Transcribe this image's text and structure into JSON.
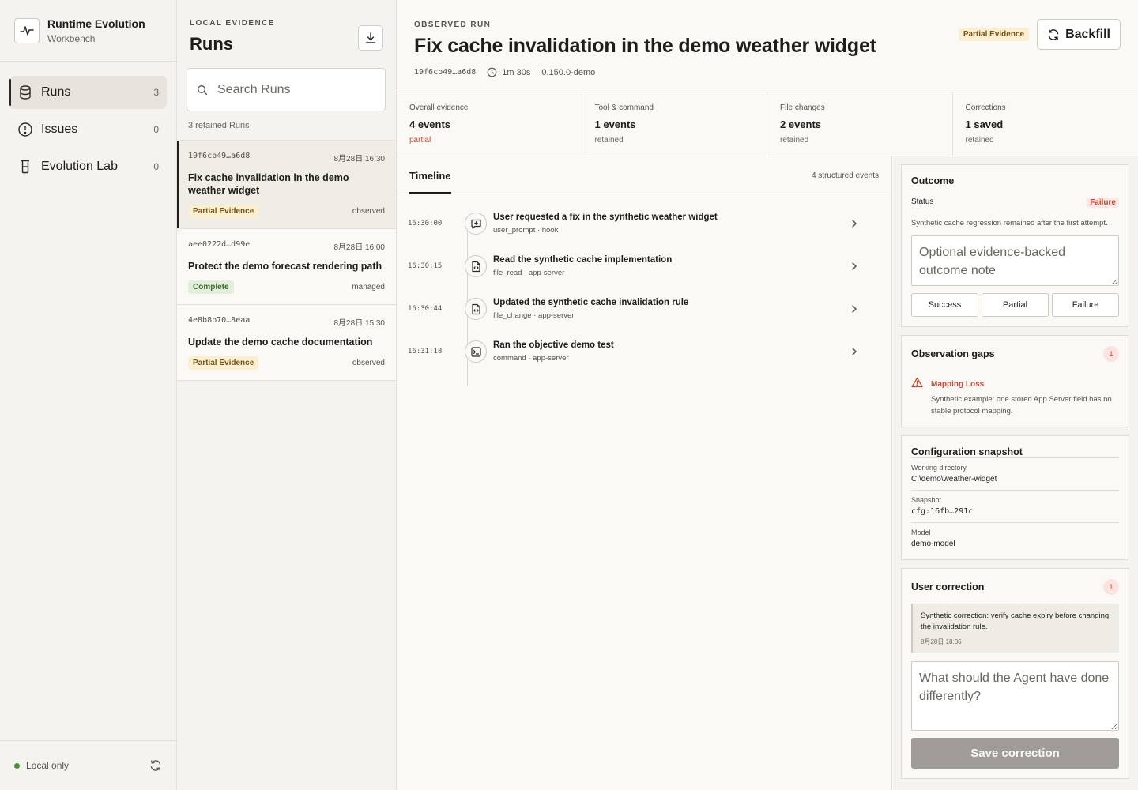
{
  "app": {
    "title": "Runtime Evolution",
    "subtitle": "Workbench"
  },
  "nav": [
    {
      "label": "Runs",
      "count": "3"
    },
    {
      "label": "Issues",
      "count": "0"
    },
    {
      "label": "Evolution Lab",
      "count": "0"
    }
  ],
  "footer": {
    "status": "Local only"
  },
  "runs_panel": {
    "eyebrow": "LOCAL EVIDENCE",
    "title": "Runs",
    "search_placeholder": "Search Runs",
    "count_text": "3 retained Runs",
    "runs": [
      {
        "id": "19f6cb49…a6d8",
        "date": "8月28日 16:30",
        "title": "Fix cache invalidation in the demo weather widget",
        "badge": "Partial Evidence",
        "state": "observed"
      },
      {
        "id": "aee0222d…d99e",
        "date": "8月28日 16:00",
        "title": "Protect the demo forecast rendering path",
        "badge": "Complete",
        "state": "managed"
      },
      {
        "id": "4e8b8b70…8eaa",
        "date": "8月28日 15:30",
        "title": "Update the demo cache documentation",
        "badge": "Partial Evidence",
        "state": "observed"
      }
    ]
  },
  "run": {
    "eyebrow": "OBSERVED RUN",
    "title": "Fix cache invalidation in the demo weather widget",
    "id": "19f6cb49…a6d8",
    "duration": "1m 30s",
    "version": "0.150.0-demo",
    "badge": "Partial Evidence",
    "backfill_label": "Backfill"
  },
  "stats": [
    {
      "label": "Overall evidence",
      "value": "4 events",
      "sub": "partial"
    },
    {
      "label": "Tool & command",
      "value": "1 events",
      "sub": "retained"
    },
    {
      "label": "File changes",
      "value": "2 events",
      "sub": "retained"
    },
    {
      "label": "Corrections",
      "value": "1 saved",
      "sub": "retained"
    }
  ],
  "timeline": {
    "tab": "Timeline",
    "count_text": "4 structured events",
    "events": [
      {
        "time": "16:30:00",
        "title": "User requested a fix in the synthetic weather widget",
        "meta": "user_prompt · hook",
        "icon": "message-plus-icon"
      },
      {
        "time": "16:30:15",
        "title": "Read the synthetic cache implementation",
        "meta": "file_read · app-server",
        "icon": "file-code-icon"
      },
      {
        "time": "16:30:44",
        "title": "Updated the synthetic cache invalidation rule",
        "meta": "file_change · app-server",
        "icon": "file-code-icon"
      },
      {
        "time": "16:31:18",
        "title": "Ran the objective demo test",
        "meta": "command · app-server",
        "icon": "terminal-icon"
      }
    ]
  },
  "outcome": {
    "title": "Outcome",
    "status_label": "Status",
    "status_value": "Failure",
    "description": "Synthetic cache regression remained after the first attempt.",
    "note_placeholder": "Optional evidence-backed outcome note",
    "buttons": [
      "Success",
      "Partial",
      "Failure"
    ]
  },
  "gaps": {
    "title": "Observation gaps",
    "count": "1",
    "item_title": "Mapping Loss",
    "item_text": "Synthetic example: one stored App Server field has no stable protocol mapping."
  },
  "config": {
    "title": "Configuration snapshot",
    "rows": [
      {
        "label": "Working directory",
        "value": "C:\\demo\\weather-widget"
      },
      {
        "label": "Snapshot",
        "value": "cfg:16fb…291c"
      },
      {
        "label": "Model",
        "value": "demo-model"
      }
    ]
  },
  "correction": {
    "title": "User correction",
    "count": "1",
    "quote": "Synthetic correction: verify cache expiry before changing the invalidation rule.",
    "quote_time": "8月28日 18:06",
    "input_placeholder": "What should the Agent have done differently?",
    "save_label": "Save correction"
  },
  "colors": {
    "accent": "#1f1d1a",
    "failure": "#c44a3a",
    "partial_badge": "#fbefd1",
    "complete_badge": "#e3efdc",
    "online": "#4c8a3a"
  }
}
